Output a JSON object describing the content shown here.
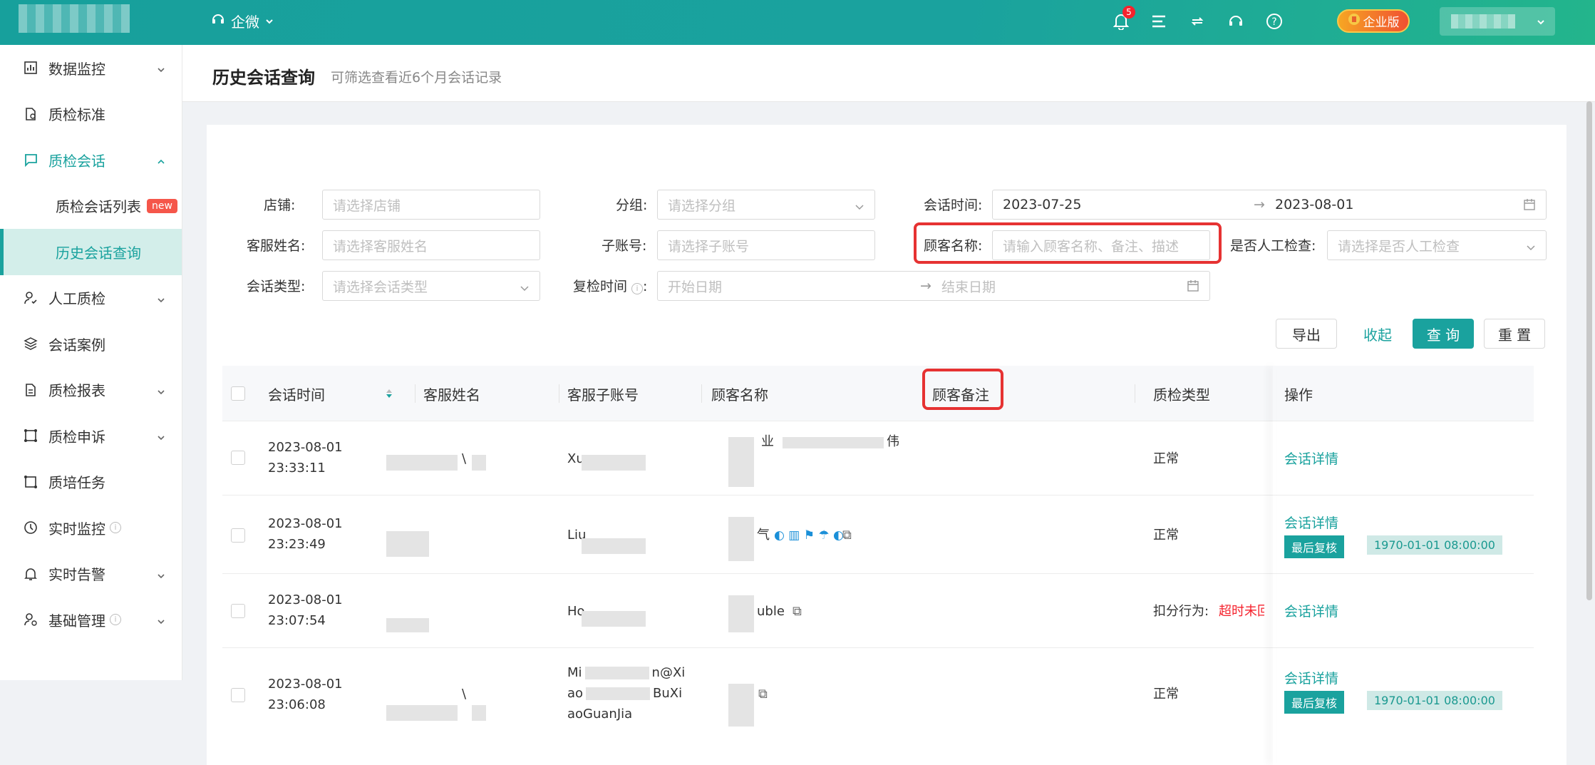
{
  "topbar": {
    "brand": "企微",
    "notification_count": "5",
    "enterprise_label": "企业版"
  },
  "sidebar": {
    "items": [
      {
        "label": "数据监控",
        "icon": "bar-chart-icon",
        "expand": true
      },
      {
        "label": "质检标准",
        "icon": "document-check-icon",
        "expand": false
      },
      {
        "label": "质检会话",
        "icon": "chat-icon",
        "expand": true
      }
    ],
    "subitems": [
      {
        "label": "质检会话列表",
        "tag": "new"
      },
      {
        "label": "历史会话查询"
      }
    ],
    "items2": [
      {
        "label": "人工质检",
        "icon": "user-check-icon",
        "expand": true
      },
      {
        "label": "会话案例",
        "icon": "layers-icon",
        "expand": false
      },
      {
        "label": "质检报表",
        "icon": "report-icon",
        "expand": true
      },
      {
        "label": "质检申诉",
        "icon": "appeal-icon",
        "expand": true
      },
      {
        "label": "质培任务",
        "icon": "task-icon",
        "expand": false
      },
      {
        "label": "实时监控",
        "icon": "clock-icon",
        "expand": false,
        "info": true
      },
      {
        "label": "实时告警",
        "icon": "bell-icon",
        "expand": true
      },
      {
        "label": "基础管理",
        "icon": "user-settings-icon",
        "expand": true,
        "info": true
      }
    ]
  },
  "page": {
    "title": "历史会话查询",
    "hint": "可筛选查看近6个月会话记录"
  },
  "filters": {
    "shop_label": "店铺:",
    "shop_placeholder": "请选择店铺",
    "group_label": "分组:",
    "group_placeholder": "请选择分组",
    "session_time_label": "会话时间:",
    "session_start": "2023-07-25",
    "session_end": "2023-08-01",
    "agent_label": "客服姓名:",
    "agent_placeholder": "请选择客服姓名",
    "subaccount_label": "子账号:",
    "subaccount_placeholder": "请选择子账号",
    "customer_label": "顾客名称:",
    "customer_placeholder": "请输入顾客名称、备注、描述",
    "manual_label": "是否人工检查:",
    "manual_placeholder": "请选择是否人工检查",
    "type_label": "会话类型:",
    "type_placeholder": "请选择会话类型",
    "recheck_label": "复检时间",
    "recheck_start": "开始日期",
    "recheck_end": "结束日期",
    "export": "导出",
    "collapse": "收起",
    "query": "查 询",
    "reset": "重 置"
  },
  "table": {
    "headers": [
      "会话时间",
      "客服姓名",
      "客服子账号",
      "顾客名称",
      "顾客备注",
      "质检类型",
      "操作"
    ],
    "rows": [
      {
        "date": "2023-08-01",
        "time": "23:33:11",
        "agent": "\\",
        "sub": "Xu",
        "customer_a": "",
        "customer_b": "业",
        "customer_c": "伟",
        "type": "正常",
        "op": "会话详情"
      },
      {
        "date": "2023-08-01",
        "time": "23:23:49",
        "agent": "",
        "sub": "Liu",
        "customer_a": "",
        "customer_b": "气",
        "customer_c": "",
        "type": "正常",
        "op": "会话详情",
        "last": "最后复核",
        "last_time": "1970-01-01 08:00:00"
      },
      {
        "date": "2023-08-01",
        "time": "23:07:54",
        "agent": "",
        "sub": "Ho",
        "customer_a": "",
        "customer_b": "uble",
        "customer_c": "",
        "type_prefix": "扣分行为:",
        "type_red": "超时未回",
        "op": "会话详情"
      },
      {
        "date": "2023-08-01",
        "time": "23:06:08",
        "agent": "\\",
        "sub_l1": "Mi",
        "sub_l1b": "n@Xi",
        "sub_l2": "ao",
        "sub_l2b": "BuXi",
        "sub_l3": "aoGuanJia",
        "customer_b": "",
        "type": "正常",
        "op": "会话详情",
        "last": "最后复核",
        "last_time": "1970-01-01 08:00:00"
      }
    ]
  }
}
